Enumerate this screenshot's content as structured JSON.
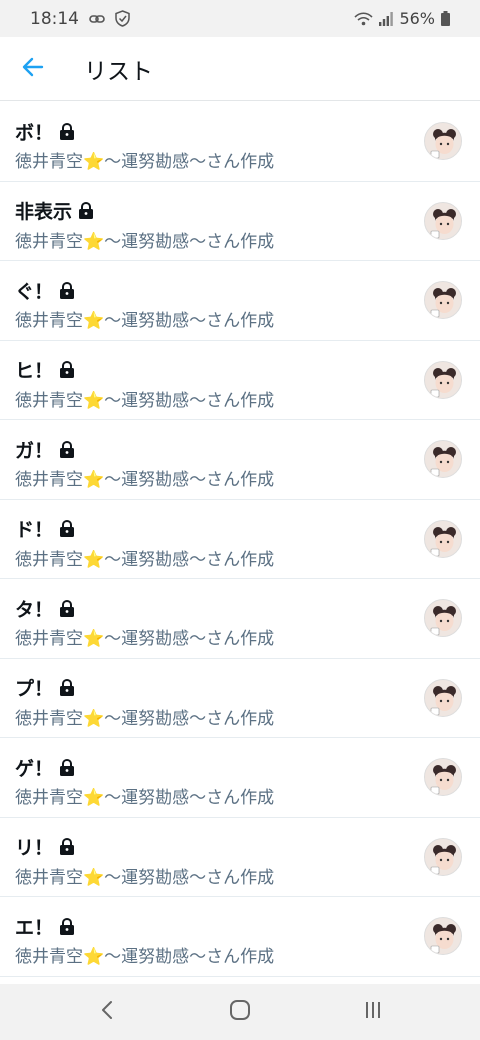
{
  "status_bar": {
    "time": "18:14",
    "battery": "56%",
    "icons": [
      "link-icon",
      "shield-icon",
      "wifi-icon",
      "signal-icon",
      "battery-icon"
    ]
  },
  "header": {
    "title": "リスト",
    "back_icon": "back-arrow-icon",
    "accent_color": "#1da1f2"
  },
  "lists": [
    {
      "name": "ボ！",
      "locked": true,
      "subtitle": "徳井青空⭐〜運努勘感〜さん作成"
    },
    {
      "name": "非表示",
      "locked": true,
      "subtitle": "徳井青空⭐〜運努勘感〜さん作成"
    },
    {
      "name": "ぐ！",
      "locked": true,
      "subtitle": "徳井青空⭐〜運努勘感〜さん作成"
    },
    {
      "name": "ヒ！",
      "locked": true,
      "subtitle": "徳井青空⭐〜運努勘感〜さん作成"
    },
    {
      "name": "ガ！",
      "locked": true,
      "subtitle": "徳井青空⭐〜運努勘感〜さん作成"
    },
    {
      "name": "ド！",
      "locked": true,
      "subtitle": "徳井青空⭐〜運努勘感〜さん作成"
    },
    {
      "name": "タ！",
      "locked": true,
      "subtitle": "徳井青空⭐〜運努勘感〜さん作成"
    },
    {
      "name": "プ！",
      "locked": true,
      "subtitle": "徳井青空⭐〜運努勘感〜さん作成"
    },
    {
      "name": "ゲ！",
      "locked": true,
      "subtitle": "徳井青空⭐〜運努勘感〜さん作成"
    },
    {
      "name": "リ！",
      "locked": true,
      "subtitle": "徳井青空⭐〜運努勘感〜さん作成"
    },
    {
      "name": "エ！",
      "locked": true,
      "subtitle": "徳井青空⭐〜運努勘感〜さん作成"
    }
  ],
  "nav_bar": {
    "icons": [
      "recent-apps-back-icon",
      "home-icon",
      "recents-icon"
    ]
  }
}
